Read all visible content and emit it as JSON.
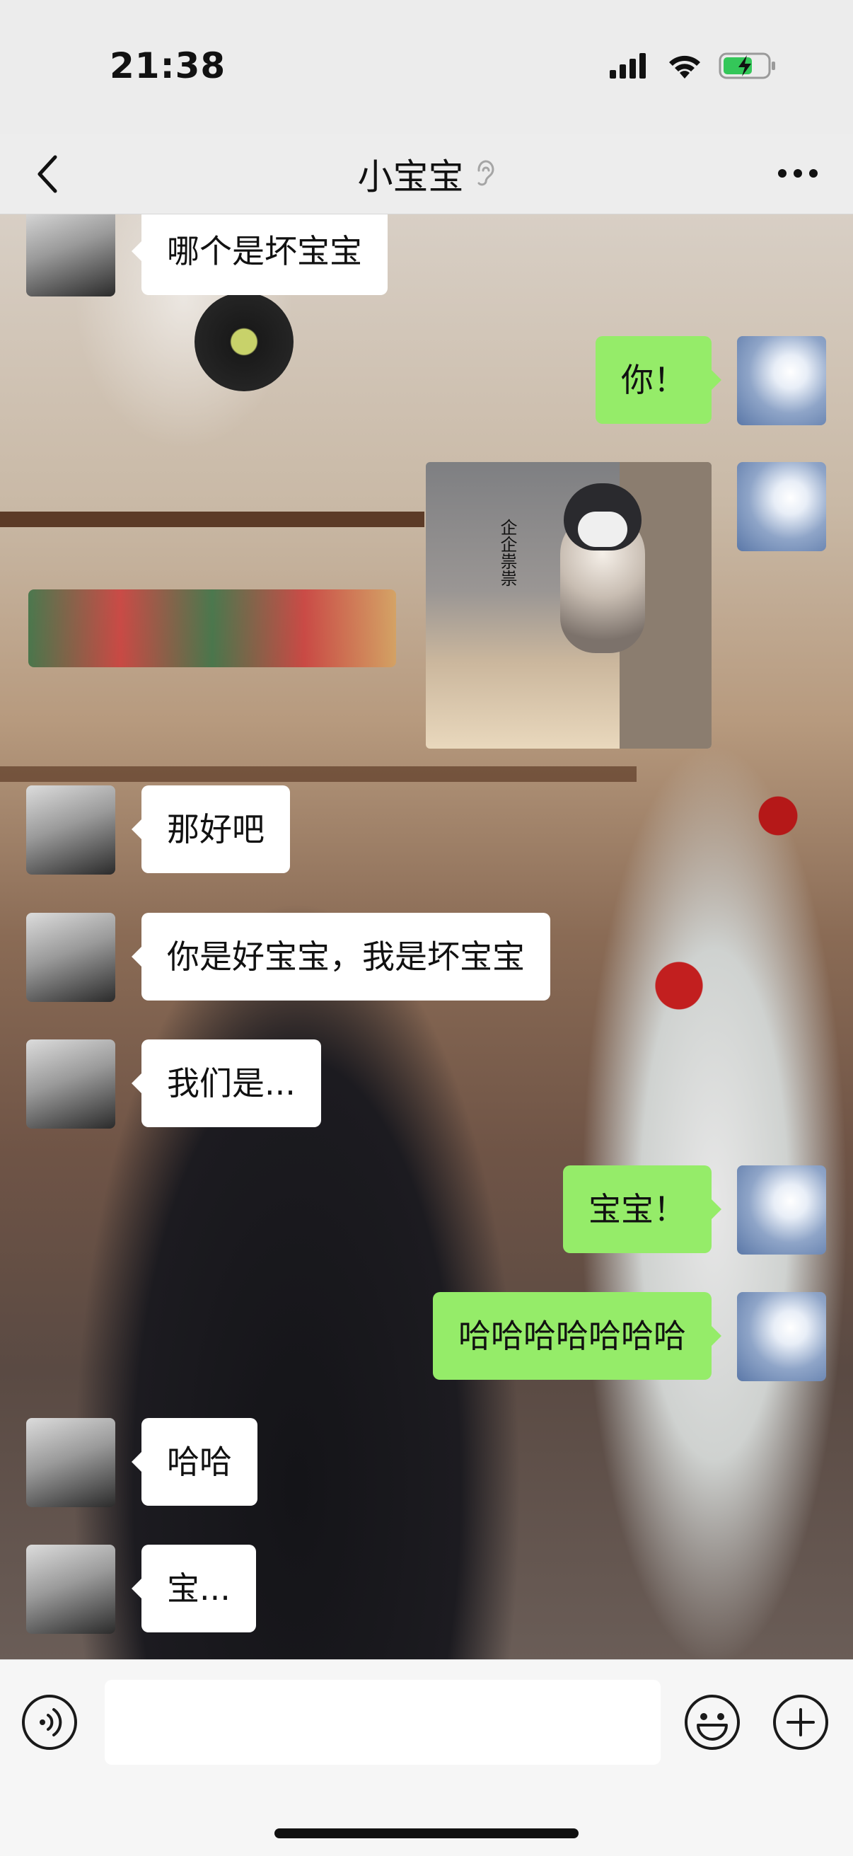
{
  "status_bar": {
    "time": "21:38",
    "signal_icon": "cellular-signal-icon",
    "wifi_icon": "wifi-icon",
    "battery_icon": "battery-charging-icon"
  },
  "nav": {
    "title": "小宝宝",
    "back_icon": "chevron-left-icon",
    "ear_icon": "ear-icon",
    "more_icon": "more-dots-icon"
  },
  "messages": [
    {
      "side": "in",
      "text": "哪个是坏宝宝"
    },
    {
      "side": "out",
      "text": "你！"
    },
    {
      "side": "out",
      "type": "sticker",
      "caption": "企企祟祟"
    },
    {
      "side": "in",
      "text": "那好吧"
    },
    {
      "side": "in",
      "text": "你是好宝宝，我是坏宝宝"
    },
    {
      "side": "in",
      "text": "我们是..."
    },
    {
      "side": "out",
      "text": "宝宝！"
    },
    {
      "side": "out",
      "text": "哈哈哈哈哈哈哈"
    },
    {
      "side": "in",
      "text": "哈哈"
    },
    {
      "side": "in",
      "text": "宝..."
    }
  ],
  "input_bar": {
    "voice_icon": "voice-icon",
    "emoji_icon": "emoji-icon",
    "plus_icon": "plus-icon",
    "value": ""
  },
  "colors": {
    "outgoing_bubble": "#95ec69",
    "incoming_bubble": "#ffffff"
  }
}
